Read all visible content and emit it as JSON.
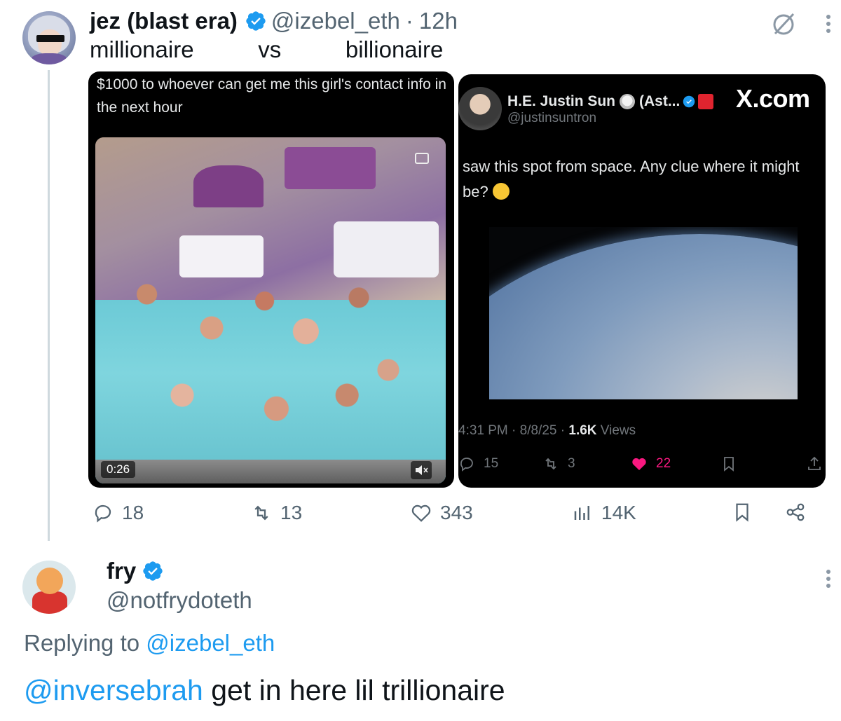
{
  "tweet": {
    "author_name": "jez (blast era)",
    "handle": "@izebel_eth",
    "time_sep": "·",
    "time": "12h",
    "text": "millionaire          vs          billionaire",
    "media_left": {
      "quote_text": "$1000 to whoever can get me this girl's contact info in the next hour",
      "video_time": "0:26"
    },
    "media_right": {
      "author_name": "H.E. Justin Sun",
      "author_suffix": "(Ast...",
      "handle": "@justinsuntron",
      "watermark": "X.com",
      "text": "saw this spot from space. Any clue where it might be?",
      "time": "4:31 PM",
      "date": "8/8/25",
      "views_count": "1.6K",
      "views_label": "Views",
      "replies": "15",
      "reposts": "3",
      "likes": "22",
      "like_color": "#f91880"
    },
    "actions": {
      "replies": "18",
      "reposts": "13",
      "likes": "343",
      "views": "14K"
    }
  },
  "reply": {
    "author_name": "fry",
    "handle": "@notfrydoteth",
    "replying_label": "Replying to",
    "replying_to": "@izebel_eth",
    "mention": "@inversebrah",
    "text": " get in here lil trillionaire"
  },
  "colors": {
    "verified": "#1d9bf0",
    "text_secondary": "#536471",
    "link": "#1d9bf0"
  }
}
